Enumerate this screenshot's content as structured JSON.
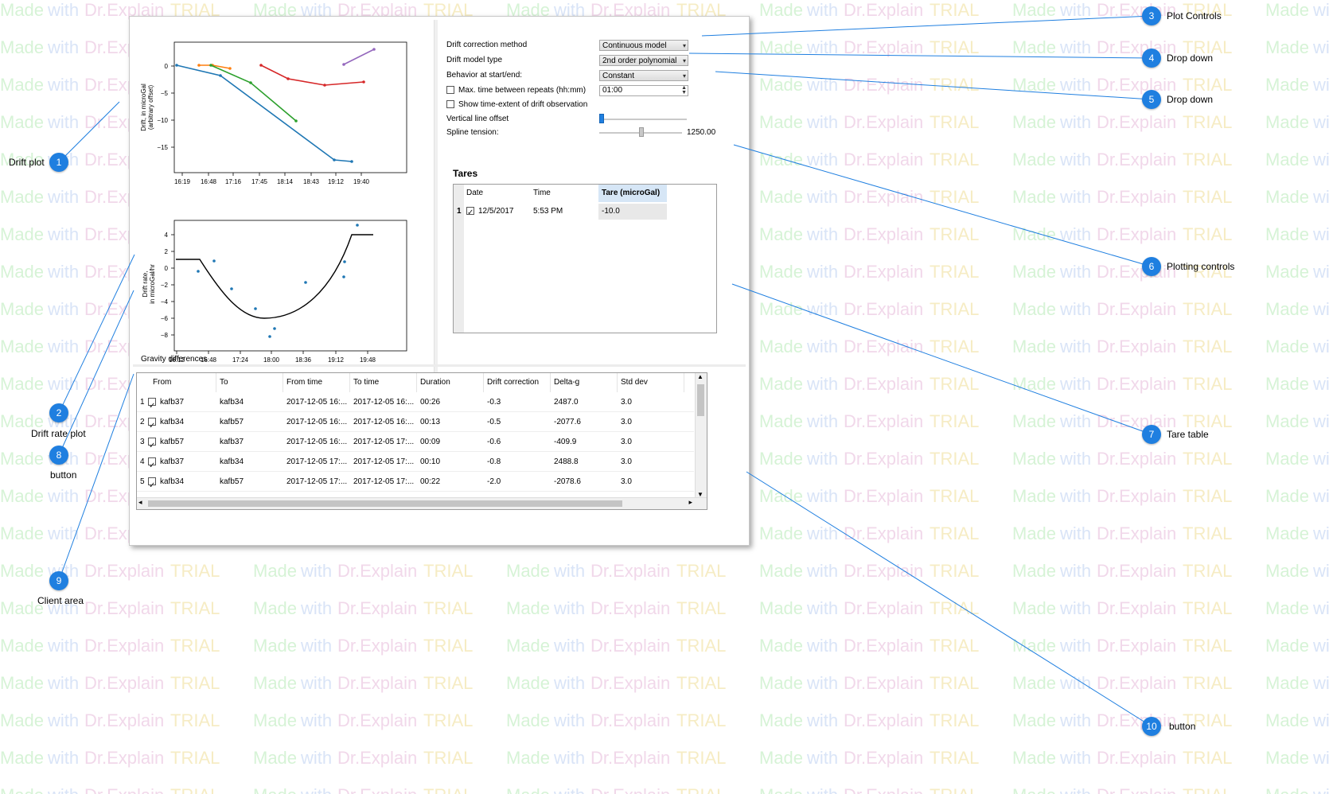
{
  "watermark": {
    "made": "Made",
    "with": "with",
    "dr": "Dr.Explain",
    "trial": "TRIAL"
  },
  "drift_plot": {
    "ylabel_line1": "Drift, in microGal",
    "ylabel_line2": "(arbitrary offset)",
    "yticks": [
      "0",
      "−5",
      "−10",
      "−15"
    ],
    "xticks": [
      "16:19",
      "16:48",
      "17:16",
      "17:45",
      "18:14",
      "18:43",
      "19:12",
      "19:40"
    ]
  },
  "drift_rate_plot": {
    "ylabel_line1": "Drift rate,",
    "ylabel_line2": "in microGal/hr",
    "yticks": [
      "4",
      "2",
      "0",
      "−2",
      "−4",
      "−6",
      "−8"
    ],
    "xticks": [
      "16:12",
      "16:48",
      "17:24",
      "18:00",
      "18:36",
      "19:12",
      "19:48"
    ]
  },
  "controls": {
    "method_label": "Drift correction method",
    "method_value": "Continuous model",
    "model_label": "Drift model type",
    "model_value": "2nd order polynomial",
    "behavior_label": "Behavior at start/end:",
    "behavior_value": "Constant",
    "max_time_label": "Max. time between repeats (hh:mm)",
    "max_time_value": "01:00",
    "show_extent_label": "Show time-extent of drift observation",
    "vertical_offset_label": "Vertical line offset",
    "spline_label": "Spline tension:",
    "spline_value": "1250.00"
  },
  "tares": {
    "title": "Tares",
    "headers": [
      "Date",
      "Time",
      "Tare (microGal)"
    ],
    "rows": [
      {
        "num": "1",
        "date": "12/5/2017",
        "time": "5:53 PM",
        "tare": "-10.0"
      }
    ]
  },
  "gravity": {
    "title": "Gravity differences",
    "headers": [
      "From",
      "To",
      "From time",
      "To time",
      "Duration",
      "Drift correction",
      "Delta-g",
      "Std dev"
    ],
    "rows": [
      {
        "num": "1",
        "from": "kafb37",
        "to": "kafb34",
        "from_time": "2017-12-05 16:...",
        "to_time": "2017-12-05 16:...",
        "duration": "00:26",
        "drift": "-0.3",
        "delta": "2487.0",
        "std": "3.0"
      },
      {
        "num": "2",
        "from": "kafb34",
        "to": "kafb57",
        "from_time": "2017-12-05 16:...",
        "to_time": "2017-12-05 16:...",
        "duration": "00:13",
        "drift": "-0.5",
        "delta": "-2077.6",
        "std": "3.0"
      },
      {
        "num": "3",
        "from": "kafb57",
        "to": "kafb37",
        "from_time": "2017-12-05 16:...",
        "to_time": "2017-12-05 17:...",
        "duration": "00:09",
        "drift": "-0.6",
        "delta": "-409.9",
        "std": "3.0"
      },
      {
        "num": "4",
        "from": "kafb37",
        "to": "kafb34",
        "from_time": "2017-12-05 17:...",
        "to_time": "2017-12-05 17:...",
        "duration": "00:10",
        "drift": "-0.8",
        "delta": "2488.8",
        "std": "3.0"
      },
      {
        "num": "5",
        "from": "kafb34",
        "to": "kafb57",
        "from_time": "2017-12-05 17:...",
        "to_time": "2017-12-05 17:...",
        "duration": "00:22",
        "drift": "-2.0",
        "delta": "-2078.6",
        "std": "3.0"
      }
    ]
  },
  "callouts": [
    {
      "num": "1",
      "label": "Drift plot"
    },
    {
      "num": "2",
      "label": "Drift rate plot"
    },
    {
      "num": "3",
      "label": "Plot Controls"
    },
    {
      "num": "4",
      "label": "Drop down"
    },
    {
      "num": "5",
      "label": "Drop down"
    },
    {
      "num": "6",
      "label": "Plotting controls"
    },
    {
      "num": "7",
      "label": "Tare table"
    },
    {
      "num": "8",
      "label": "button"
    },
    {
      "num": "9",
      "label": "Client area"
    },
    {
      "num": "10",
      "label": "button"
    }
  ],
  "colors": {
    "accent": "#1f7fe0",
    "series_blue": "#1f77b4",
    "series_orange": "#ff7f0e",
    "series_green": "#2ca02c",
    "series_red": "#d62728",
    "series_purple": "#9467bd"
  }
}
